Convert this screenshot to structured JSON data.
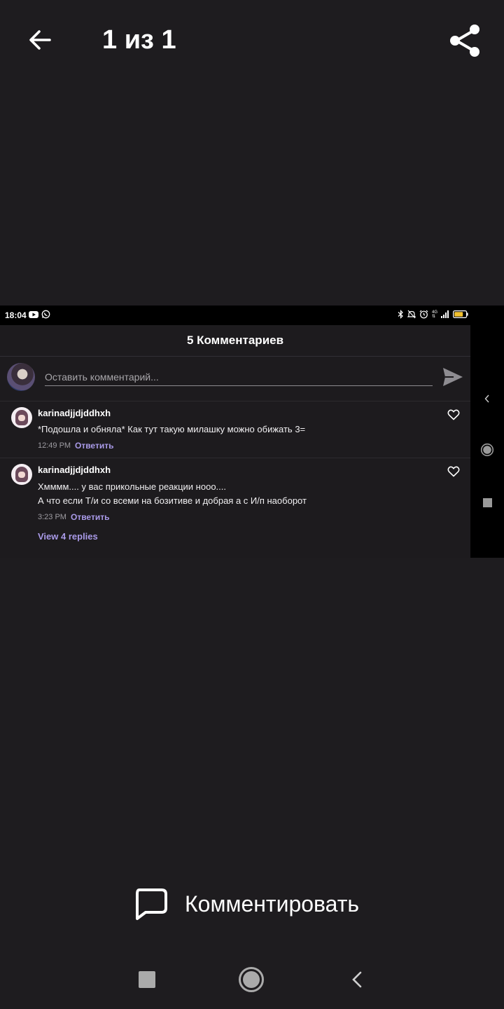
{
  "viewer": {
    "counter": "1 из 1",
    "back_icon": "arrow-left-icon",
    "share_icon": "share-icon"
  },
  "embedded_screenshot": {
    "status_bar": {
      "time": "18:04",
      "network_label_top": "4G",
      "network_label_bottom": "⇅",
      "icons": [
        "youtube-icon",
        "whatsapp-icon",
        "bluetooth-icon",
        "mute-icon",
        "alarm-icon",
        "signal-icon",
        "battery-icon"
      ],
      "battery_color": "#f2c12e"
    },
    "comments_header": {
      "title": "5 Комментариев"
    },
    "composer": {
      "placeholder": "Оставить комментарий...",
      "value": ""
    },
    "comments": [
      {
        "user": "karinadjjdjddhxh",
        "lines": [
          "*Подошла и обняла* Как тут такую милашку можно обижать 3="
        ],
        "time": "12:49 PM",
        "reply_label": "Ответить"
      },
      {
        "user": "karinadjjdjddhxh",
        "lines": [
          "Хмммм.... у вас прикольные реакции нооо....",
          "А что если Т/и со всеми на бозитиве и добрая а с И/п наоборот"
        ],
        "time": "3:23 PM",
        "reply_label": "Ответить",
        "view_replies": "View 4 replies"
      }
    ]
  },
  "bottom_action": {
    "label": "Комментировать",
    "icon": "comment-bubble-icon"
  },
  "colors": {
    "background": "#1e1c1f",
    "accent": "#a99ae8"
  }
}
